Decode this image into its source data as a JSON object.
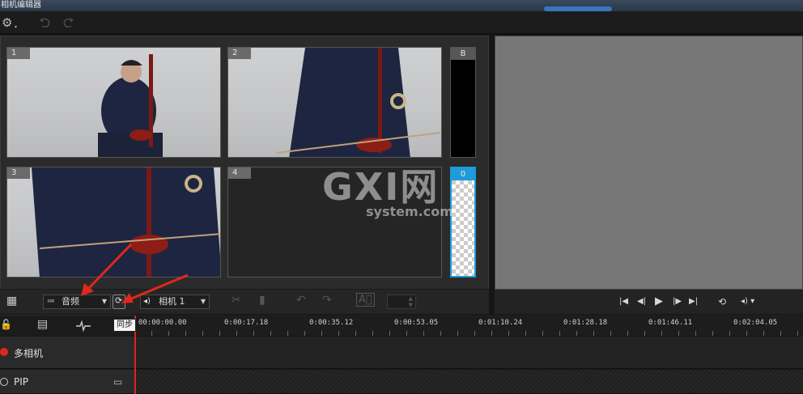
{
  "window": {
    "title": "相机编辑器"
  },
  "toolbar": {
    "settings_icon": "gear-icon",
    "undo_icon": "undo-icon",
    "redo_icon": "redo-icon"
  },
  "cameras": [
    {
      "label": "1"
    },
    {
      "label": "2"
    },
    {
      "label": "3"
    },
    {
      "label": "4"
    }
  ],
  "side_cameras": [
    {
      "label": "B"
    },
    {
      "label": "0"
    }
  ],
  "controls": {
    "sync_source_value": "音频",
    "sync_tooltip": "同步",
    "audio_source_value": "相机 1"
  },
  "ruler": {
    "ticks": [
      "00:00:00.00",
      "0:00:17.18",
      "0:00:35.12",
      "0:00:53.05",
      "0:01:10.24",
      "0:01:28.18",
      "0:01:46.11",
      "0:02:04.05"
    ]
  },
  "tracks": [
    {
      "name": "多相机",
      "color": "#e0281c"
    },
    {
      "name": "PIP",
      "color": "#cccccc"
    }
  ],
  "watermark": {
    "line1": "GXI网",
    "line2": "system.com"
  },
  "colors": {
    "accent": "#1e9bd8",
    "annotation": "#e0281c",
    "playhead": "#dd2222"
  }
}
